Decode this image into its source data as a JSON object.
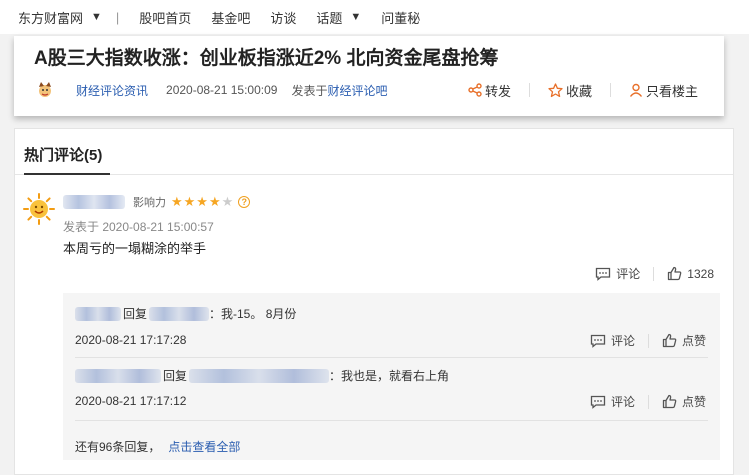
{
  "nav": {
    "items": [
      "东方财富网",
      "股吧首页",
      "基金吧",
      "访谈",
      "话题",
      "问董秘"
    ],
    "separator": "|"
  },
  "article": {
    "title": "A股三大指数收涨：创业板指涨近2% 北向资金尾盘抢筹",
    "author": "财经评论资讯",
    "date": "2020-08-21 15:00:09",
    "posted_in_prefix": "发表于",
    "posted_in_bar": "财经评论吧",
    "actions": {
      "share": "转发",
      "favorite": "收藏",
      "only_author": "只看楼主"
    }
  },
  "comments": {
    "section_title": "热门评论(5)",
    "hot": {
      "influence_label": "影响力",
      "stars_filled": 4,
      "stars_total": 5,
      "stars_full": "★★★★",
      "stars_empty": "★",
      "help": "?",
      "time": "发表于 2020-08-21 15:00:57",
      "text": "本周亏的一塌糊涂的举手",
      "comment_label": "评论",
      "like_count": "1328"
    },
    "replies": [
      {
        "reply_word": "回复",
        "text": "：我-15。 8月份",
        "date": "2020-08-21 17:17:28",
        "comment_label": "评论",
        "like_label": "点赞"
      },
      {
        "reply_word": "回复",
        "text": "：我也是，就看右上角",
        "date": "2020-08-21 17:17:12",
        "comment_label": "评论",
        "like_label": "点赞"
      }
    ],
    "more_text": "还有96条回复，",
    "more_link": "点击查看全部"
  },
  "colors": {
    "link": "#2a5db0",
    "star": "#f6a623",
    "accent_orange": "#e8702a"
  },
  "icons": [
    "caret-down-icon",
    "author-avatar-icon",
    "share-icon",
    "star-outline-icon",
    "user-icon",
    "sun-avatar-icon",
    "help-icon",
    "comment-icon",
    "thumbs-up-icon"
  ]
}
